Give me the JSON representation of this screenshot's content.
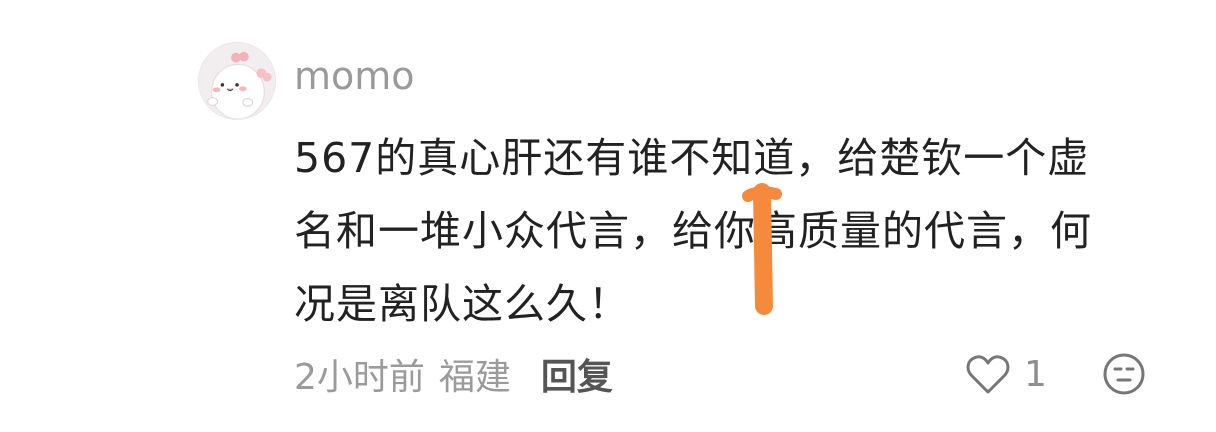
{
  "comment": {
    "username": "momo",
    "content": "567的真心肝还有谁不知道，给楚钦一个虚\n名和一堆小众代言，给你高质量的代言，何\n况是离队这么久！",
    "time": "2小时前",
    "location": "福建",
    "reply_label": "回复",
    "like_count": "1"
  },
  "icons": {
    "avatar": "cartoon-avatar-icon",
    "like": "heart-outline-icon",
    "emoji": "emoji-face-icon",
    "overlay": "orange-marker-stroke"
  },
  "colors": {
    "username": "#9a9a9a",
    "content": "#222222",
    "meta": "#9b9b9b",
    "reply": "#555555",
    "marker": "#f58a3c"
  }
}
